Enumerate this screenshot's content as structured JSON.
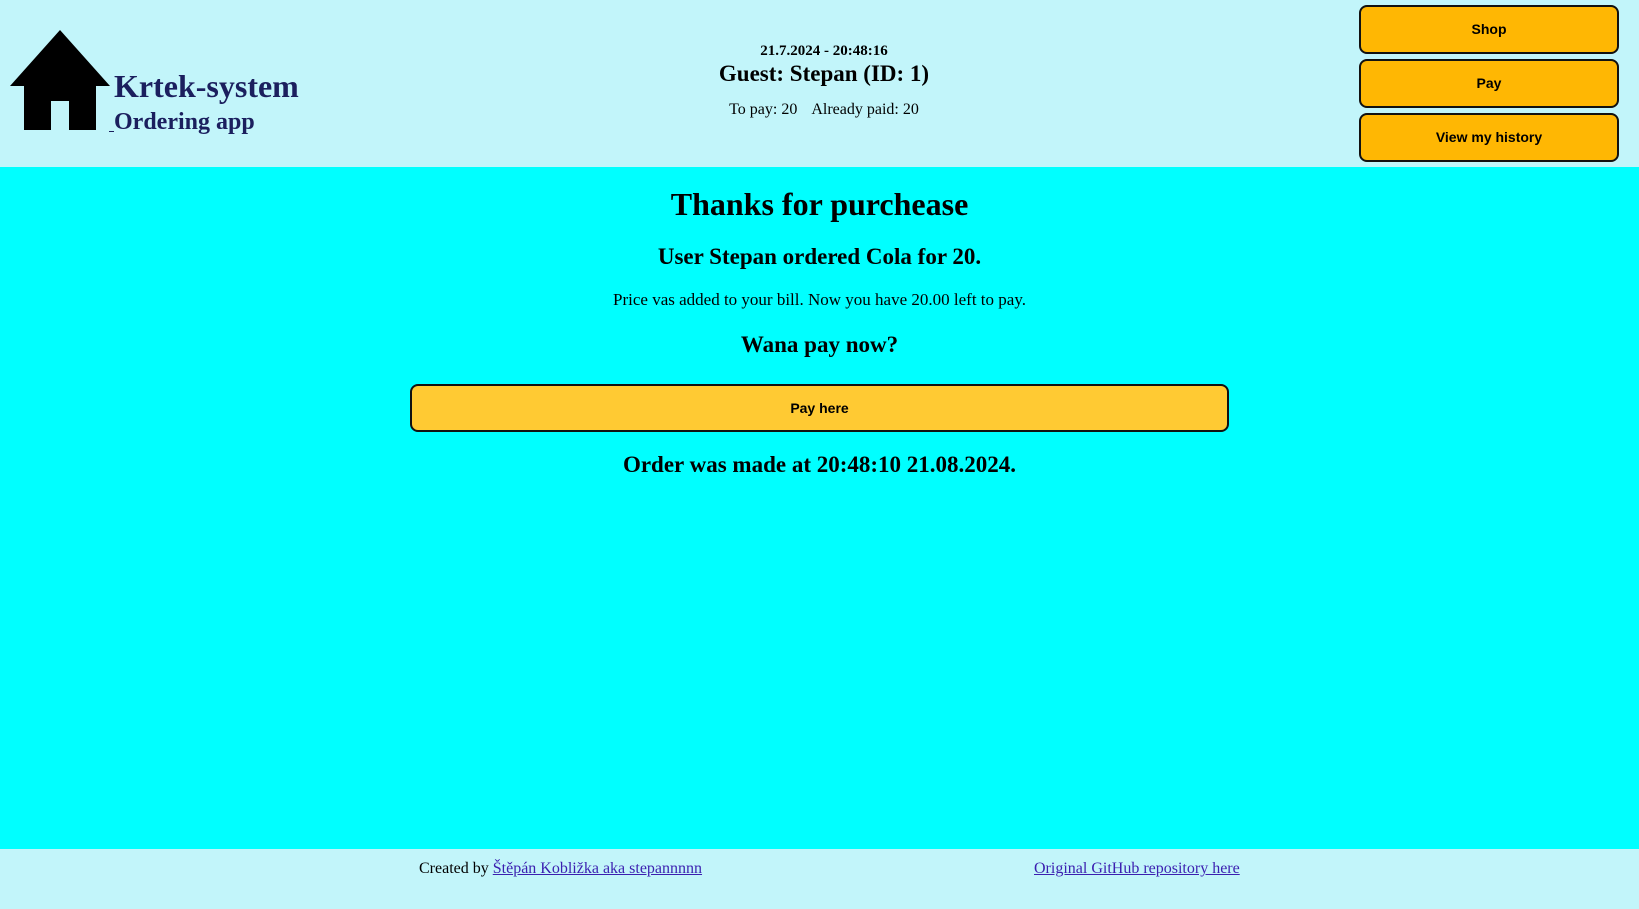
{
  "header": {
    "brand": {
      "title": "Krtek-system",
      "subtitle": "Ordering app",
      "logo_icon": "home-icon"
    },
    "datetime": "21.7.2024 - 20:48:16",
    "guest": "Guest: Stepan (ID: 1)",
    "to_pay": "To pay: 20",
    "already_paid": "Already paid: 20",
    "nav": {
      "shop_label": "Shop",
      "pay_label": "Pay",
      "history_label": "View my history"
    }
  },
  "main": {
    "heading": "Thanks for purchease",
    "ordered": "User Stepan ordered Cola for 20.",
    "price_note": "Price vas added to your bill. Now you have 20.00 left to pay.",
    "question": "Wana pay now?",
    "pay_here_label": "Pay here",
    "order_time": "Order was made at 20:48:10 21.08.2024."
  },
  "footer": {
    "created_by": "Created by",
    "author_link": "Štěpán Kobližka aka stepannnnn",
    "repo_link": "Original GitHub repository here"
  },
  "colors": {
    "header_bg": "#c2f5fa",
    "main_bg": "#00ffff",
    "button_bg": "#ffb703",
    "pay_here_bg": "#ffca33",
    "brand_text": "#1b1f5e",
    "link": "#3b1fb0"
  }
}
